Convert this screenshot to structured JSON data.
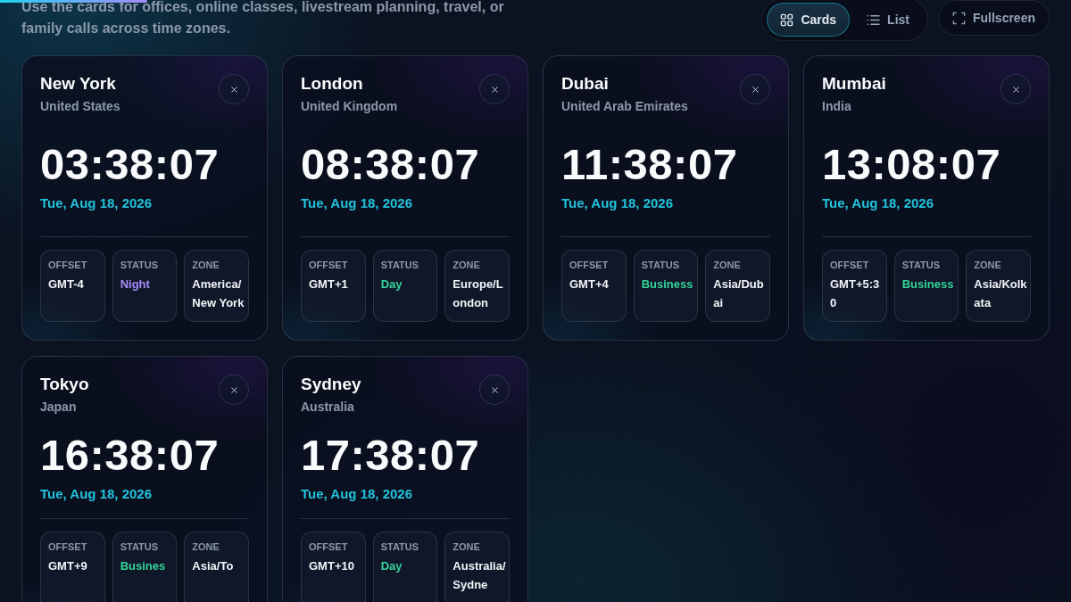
{
  "progress": {
    "level": 0.1375
  },
  "subtitle": "Use the cards for offices, online classes, livestream planning, travel, or family calls across time zones.",
  "view_toggle": [
    {
      "label": "Cards",
      "kind": "grid",
      "selected": true
    },
    {
      "label": "List",
      "kind": "list",
      "selected": false
    }
  ],
  "fullscreen_button": {
    "label": "Fullscreen"
  },
  "cities": [
    {
      "name": "New York",
      "country": "United States",
      "time": "03:38:07",
      "date": "Tue, Aug 18, 2026",
      "details": [
        {
          "label": "OFFSET",
          "value": "GMT-4"
        },
        {
          "label": "STATUS",
          "value": "Night",
          "color": "#a78bfa"
        },
        {
          "label": "ZONE",
          "value": "America/New York"
        }
      ]
    },
    {
      "name": "London",
      "country": "United Kingdom",
      "time": "08:38:07",
      "date": "Tue, Aug 18, 2026",
      "details": [
        {
          "label": "OFFSET",
          "value": "GMT+1"
        },
        {
          "label": "STATUS",
          "value": "Day",
          "color": "#34d399"
        },
        {
          "label": "ZONE",
          "value": "Europe/London"
        }
      ]
    },
    {
      "name": "Dubai",
      "country": "United Arab Emirates",
      "time": "11:38:07",
      "date": "Tue, Aug 18, 2026",
      "details": [
        {
          "label": "OFFSET",
          "value": "GMT+4"
        },
        {
          "label": "STATUS",
          "value": "Business",
          "color": "#34d399"
        },
        {
          "label": "ZONE",
          "value": "Asia/Dubai"
        }
      ]
    },
    {
      "name": "Mumbai",
      "country": "India",
      "time": "13:08:07",
      "date": "Tue, Aug 18, 2026",
      "details": [
        {
          "label": "OFFSET",
          "value": "GMT+5:30"
        },
        {
          "label": "STATUS",
          "value": "Business",
          "color": "#34d399"
        },
        {
          "label": "ZONE",
          "value": "Asia/Kolkata"
        }
      ]
    },
    {
      "name": "Tokyo",
      "country": "Japan",
      "time": "16:38:07",
      "date": "Tue, Aug 18, 2026",
      "details": [
        {
          "label": "OFFSET",
          "value": "GMT+9"
        },
        {
          "label": "STATUS",
          "value": "Busines",
          "color": "#34d399"
        },
        {
          "label": "ZONE",
          "value": "Asia/To"
        }
      ]
    },
    {
      "name": "Sydney",
      "country": "Australia",
      "time": "17:38:07",
      "date": "Tue, Aug 18, 2026",
      "details": [
        {
          "label": "OFFSET",
          "value": "GMT+10"
        },
        {
          "label": "STATUS",
          "value": "Day",
          "color": "#34d399"
        },
        {
          "label": "ZONE",
          "value": "Australia/Sydne"
        }
      ]
    }
  ]
}
